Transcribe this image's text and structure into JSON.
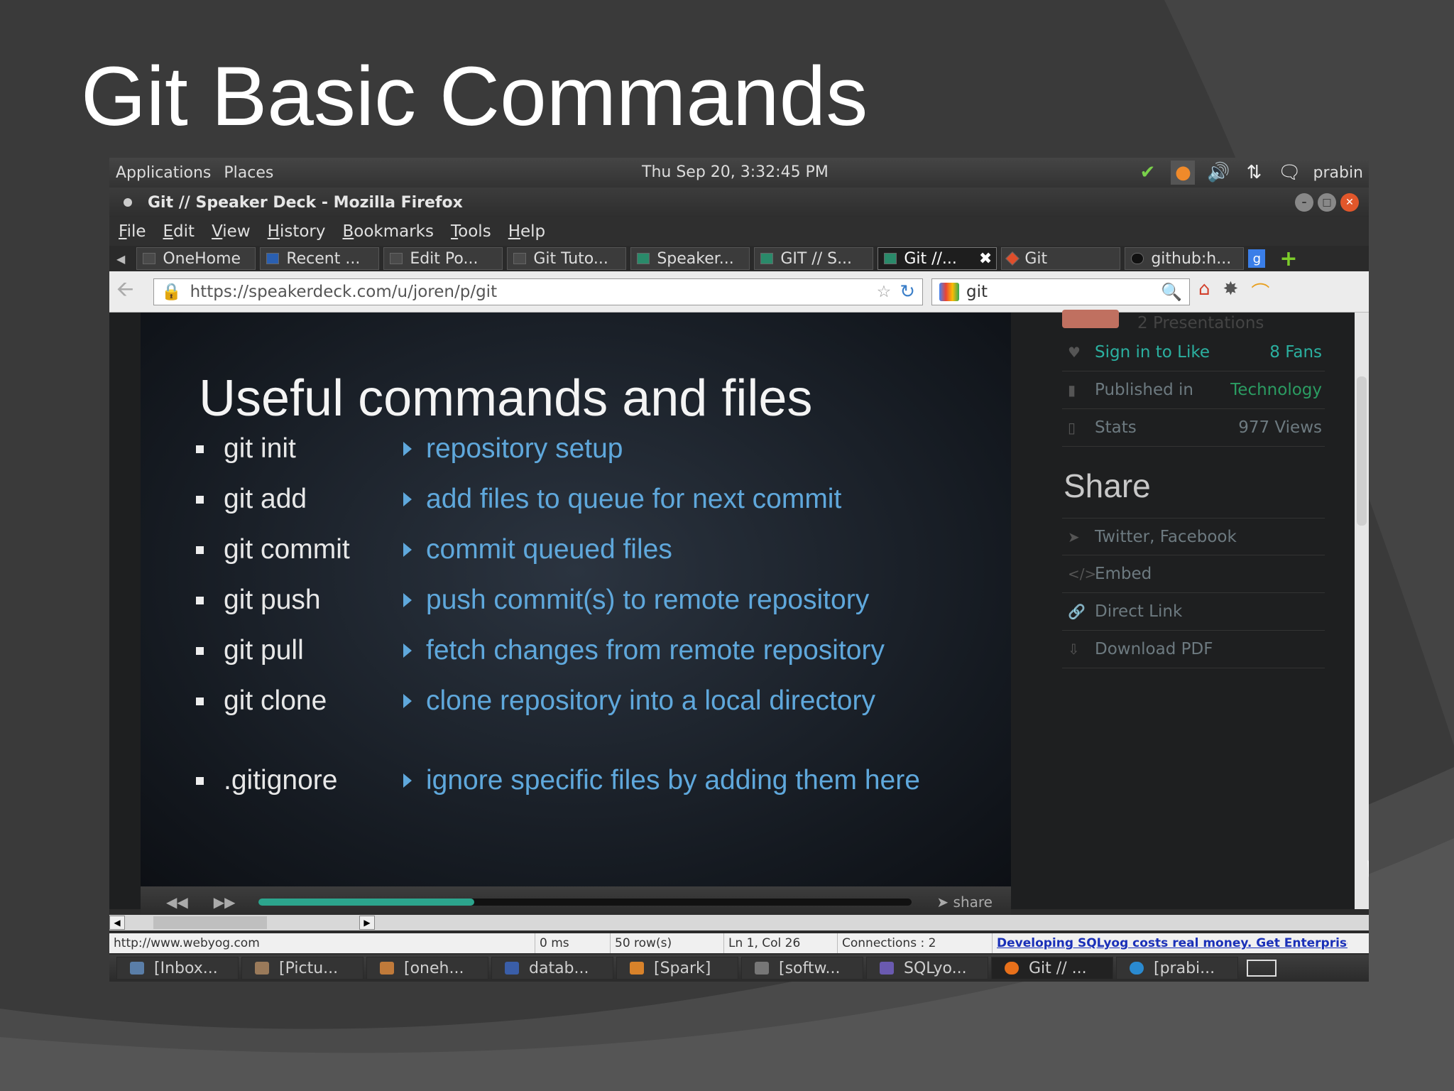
{
  "slide": {
    "title": "Git Basic Commands"
  },
  "gnome_panel": {
    "menus": [
      "Applications",
      "Places"
    ],
    "clock": "Thu Sep 20,  3:32:45 PM",
    "user": "prabin"
  },
  "window": {
    "title": "Git // Speaker Deck - Mozilla Firefox"
  },
  "menubar": [
    "File",
    "Edit",
    "View",
    "History",
    "Bookmarks",
    "Tools",
    "Help"
  ],
  "tabs": [
    {
      "label": "OneHome"
    },
    {
      "label": "Recent ..."
    },
    {
      "label": "Edit Po..."
    },
    {
      "label": "Git Tuto..."
    },
    {
      "label": "Speaker..."
    },
    {
      "label": "GIT // S..."
    },
    {
      "label": "Git //...",
      "active": true
    },
    {
      "label": "Git"
    },
    {
      "label": "github:h..."
    }
  ],
  "navbar": {
    "url": "https://speakerdeck.com/u/joren/p/git",
    "search": "git"
  },
  "presentation": {
    "heading": "Useful commands and files",
    "items": [
      {
        "cmd": "git init",
        "desc": "repository setup"
      },
      {
        "cmd": "git add",
        "desc": "add files to queue for next commit"
      },
      {
        "cmd": "git commit",
        "desc": "commit queued files"
      },
      {
        "cmd": "git push",
        "desc": "push commit(s) to remote repository"
      },
      {
        "cmd": "git pull",
        "desc": "fetch changes from remote repository"
      },
      {
        "cmd": "git clone",
        "desc": "clone repository into a local directory"
      },
      {
        "cmd": ".gitignore",
        "desc": "ignore specific files by adding them here"
      }
    ],
    "player": {
      "share": "share",
      "progress": 0.33
    }
  },
  "sidebar": {
    "presentations": "2 Presentations",
    "sign_in": "Sign in to Like",
    "fans": "8 Fans",
    "published_label": "Published in",
    "published_value": "Technology",
    "stats_label": "Stats",
    "stats_value": "977 Views",
    "share_heading": "Share",
    "share_items": [
      "Twitter, Facebook",
      "Embed",
      "Direct Link",
      "Download PDF"
    ]
  },
  "statusbar": {
    "url": "http://www.webyog.com",
    "time": "0 ms",
    "rows": "50 row(s)",
    "position": "Ln 1, Col 26",
    "connections": "Connections : 2",
    "ad": "Developing SQLyog costs real money. Get Enterprise"
  },
  "taskbar": [
    "[Inbox...",
    "[Pictu...",
    "[oneh...",
    "datab...",
    "[Spark]",
    "[softw...",
    "SQLyo...",
    "Git // ...",
    "[prabi..."
  ]
}
